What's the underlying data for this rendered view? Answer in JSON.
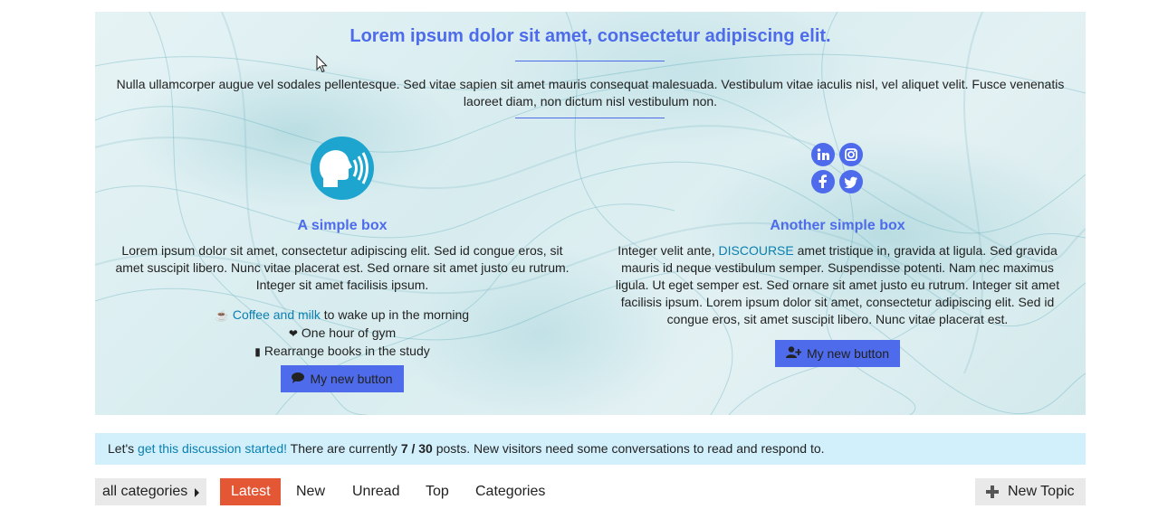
{
  "banner": {
    "title": "Lorem ipsum dolor sit amet, consectetur adipiscing elit.",
    "text": "Nulla ullamcorper augue vel sodales pellentesque. Sed vitae sapien sit amet mauris consequat malesuada. Vestibulum vitae iaculis nisl, vel aliquet velit. Fusce venenatis laoreet diam, non dictum nisl vestibulum non.",
    "accent_color": "#4d6bea"
  },
  "box_left": {
    "icon": "voice-speaking-icon",
    "title": "A simple box",
    "text": "Lorem ipsum dolor sit amet, consectetur adipiscing elit. Sed id congue eros, sit amet suscipit libero. Nunc vitae placerat est. Sed ornare sit amet justo eu rutrum. Integer sit amet facilisis ipsum.",
    "list": [
      {
        "icon": "coffee-icon",
        "link": "Coffee and milk",
        "text": " to wake up in the morning"
      },
      {
        "icon": "heartbeat-icon",
        "text": "One hour of gym"
      },
      {
        "icon": "book-icon",
        "text": "Rearrange books in the study"
      }
    ],
    "button_label": "My new button",
    "button_icon": "comment-icon"
  },
  "box_right": {
    "social_icons": [
      "linkedin-icon",
      "instagram-icon",
      "facebook-icon",
      "twitter-icon"
    ],
    "title": "Another simple box",
    "text_before": "Integer velit ante, ",
    "link": "DISCOURSE",
    "text_after": " amet tristique in, gravida at ligula. Sed gravida mauris id neque vestibulum semper. Suspendisse potenti. Nam nec maximus ligula. Ut eget semper est. Sed ornare sit amet justo eu rutrum. Integer sit amet facilisis ipsum. Lorem ipsum dolor sit amet, consectetur adipiscing elit. Sed id congue eros, sit amet suscipit libero. Nunc vitae placerat est.",
    "button_label": "My new button",
    "button_icon": "user-plus-icon"
  },
  "notice": {
    "prefix": "Let's ",
    "link": "get this discussion started!",
    "middle": " There are currently ",
    "count": "7 / 30",
    "suffix": " posts. New visitors need some conversations to read and respond to.",
    "background": "#d1f0fc"
  },
  "nav": {
    "category_dropdown": "all categories",
    "items": [
      "Latest",
      "New",
      "Unread",
      "Top",
      "Categories"
    ],
    "active": "Latest",
    "active_color": "#e45735",
    "new_topic_label": "New Topic"
  }
}
